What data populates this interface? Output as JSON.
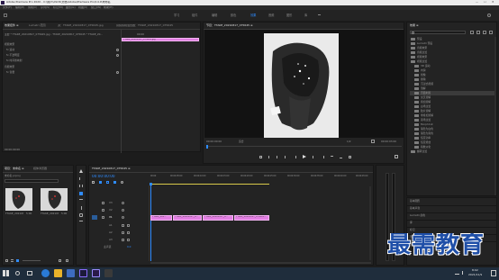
{
  "window": {
    "title": "Adobe Premiere Pro 2020 - C:\\用户\\ASUS\\文档\\Adobe\\Premiere Pro\\14.0\\未命名",
    "controls": [
      "—",
      "☐",
      "✕"
    ]
  },
  "menu": [
    "文件(F)",
    "编辑(E)",
    "剪辑(C)",
    "序列(S)",
    "标记(M)",
    "图形(G)",
    "视图(V)",
    "窗口(W)",
    "帮助(H)"
  ],
  "workspaces": {
    "items": [
      "学习",
      "组件",
      "编辑",
      "颜色",
      "效果",
      "音频",
      "图形",
      "库"
    ],
    "active_index": 4
  },
  "effect_controls": {
    "tabs": [
      "效果控件 ≡",
      "Lumetri 范围",
      "源：TTAKE_20210817_075645.jpg",
      "音频剪辑混合器：TTAKE_20210817_075645"
    ],
    "header": "主要 * TTAKE_20210817_075645.jpg  ›  TTAKE_20210817_075645 * TTAKE_20...",
    "mini_timecode": "00:00",
    "clip_label": "TTAKE_20210817_075645.jpg",
    "section": "视频效果",
    "rows": [
      "fx  运动",
      "fx  不透明度",
      "fx  时间重映射"
    ],
    "audio_section": "音频效果",
    "audio_rows": [
      "fx  音量"
    ],
    "timecode": "00:00:00:00"
  },
  "program": {
    "tab": "节目：TTAKE_20210817_075645 ≡",
    "timecode_left": "00:00:00:00",
    "fit": "适合",
    "quality": "1/2",
    "timecode_right": "00:00:03:00"
  },
  "effects": {
    "title": "效果 ≡",
    "tree": [
      {
        "label": "预设",
        "level": 0
      },
      {
        "label": "Lumetri 预设",
        "level": 0
      },
      {
        "label": "音频效果",
        "level": 0
      },
      {
        "label": "音频过渡",
        "level": 0
      },
      {
        "label": "视频效果",
        "level": 0
      },
      {
        "label": "视频过渡",
        "level": 0
      },
      {
        "label": "3D 运动",
        "level": 1
      },
      {
        "label": "内滑",
        "level": 1
      },
      {
        "label": "划像",
        "level": 1
      },
      {
        "label": "擦除",
        "level": 1
      },
      {
        "label": "沉浸式视频",
        "level": 1
      },
      {
        "label": "溶解",
        "level": 1
      },
      {
        "label": "页面剥落",
        "level": 1
      }
    ],
    "selected_index": 12,
    "tree2": [
      "交叉溶解",
      "叠加溶解",
      "白场过渡",
      "胶片溶解",
      "非叠加溶解",
      "黑场过渡",
      "MorphCut",
      "渐隐为白色",
      "渐隐为黑色",
      "恒定功率",
      "恒定增益",
      "指数淡化",
      "翻转过渡"
    ],
    "bottom_panels": [
      "基本图形",
      "基本声音",
      "Lumetri 颜色",
      "库",
      "标记",
      "历史记录",
      "信息"
    ]
  },
  "project": {
    "tabs": [
      "项目：未命名 ≡",
      "媒体浏览器"
    ],
    "name": "未命名.prproj",
    "items": [
      {
        "name": "TTAKE_20210817...",
        "duration": "5:00"
      },
      {
        "name": "TTAKE_20210817...",
        "duration": "5:00"
      }
    ]
  },
  "timeline": {
    "tab": "TTAKE_20210817_075645 ≡",
    "timecode": "00:00:00:00",
    "ruler": [
      "00:00",
      "00:00:05:00",
      "00:00:10:00",
      "00:00:15:00",
      "00:00:20:00",
      "00:00:25:00",
      "00:00:30:00",
      "00:00:35:00",
      "00:00:40:00",
      "00:00:45:00"
    ],
    "tracks": [
      "V3",
      "V2",
      "V1",
      "A1",
      "A2",
      "A3"
    ],
    "master": "主声道",
    "master_value": "0.0",
    "clips": [
      "TTAKE_202...",
      "TTAKE_20210817_0...",
      "TTAKE_20210817_0...",
      "TTAKE_20210817_075645..."
    ]
  },
  "watermark": "最需教育",
  "taskbar": {
    "time": "8:02",
    "date": "2021/11/9"
  },
  "colors": {
    "accent_blue": "#2f8cff",
    "clip_pink": "#e27ee2",
    "panel_bg": "#232323",
    "watermark_blue": "#1f4fa8"
  }
}
